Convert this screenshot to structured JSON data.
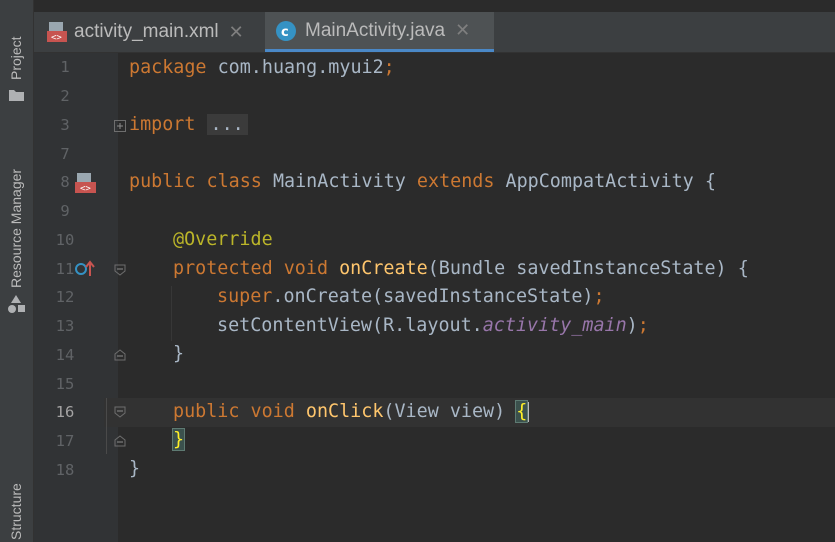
{
  "sidebar": {
    "project_label": "Project",
    "resource_label": "Resource Manager",
    "structure_label": "Structure"
  },
  "tabs": [
    {
      "label": "activity_main.xml",
      "icon": "xml-file-icon",
      "active": false
    },
    {
      "label": "MainActivity.java",
      "icon": "java-class-icon",
      "active": true
    }
  ],
  "line_numbers": [
    "1",
    "2",
    "3",
    "7",
    "8",
    "9",
    "10",
    "11",
    "12",
    "13",
    "14",
    "15",
    "16",
    "17",
    "18"
  ],
  "current_line": "16",
  "code": {
    "l1": {
      "kw": "package",
      "rest": " com.huang.myui2",
      "semi": ";"
    },
    "l3": {
      "kw": "import",
      "collapsed": "..."
    },
    "l8": {
      "kw1": "public",
      "kw2": "class",
      "name": "MainActivity",
      "kw3": "extends",
      "parent": "AppCompatActivity",
      "brace": "{"
    },
    "l10": {
      "annotation": "@Override"
    },
    "l11": {
      "kw1": "protected",
      "kw2": "void",
      "fn": "onCreate",
      "params": "(Bundle savedInstanceState)",
      "brace": "{"
    },
    "l12": {
      "kw": "super",
      "rest": ".onCreate(savedInstanceState)",
      "semi": ";"
    },
    "l13": {
      "call": "setContentView(R.layout.",
      "field": "activity_main",
      "close": ")",
      "semi": ";"
    },
    "l14": {
      "brace": "}"
    },
    "l16": {
      "kw1": "public",
      "kw2": "void",
      "fn": "onClick",
      "params": "(View view)",
      "brace": "{"
    },
    "l17": {
      "brace": "}"
    },
    "l18": {
      "brace": "}"
    }
  },
  "colors": {
    "background": "#2B2B2B",
    "keyword": "#CC7832",
    "function": "#FFC66D",
    "annotation": "#BBB529",
    "field": "#9876AA",
    "text": "#A9B7C6"
  }
}
